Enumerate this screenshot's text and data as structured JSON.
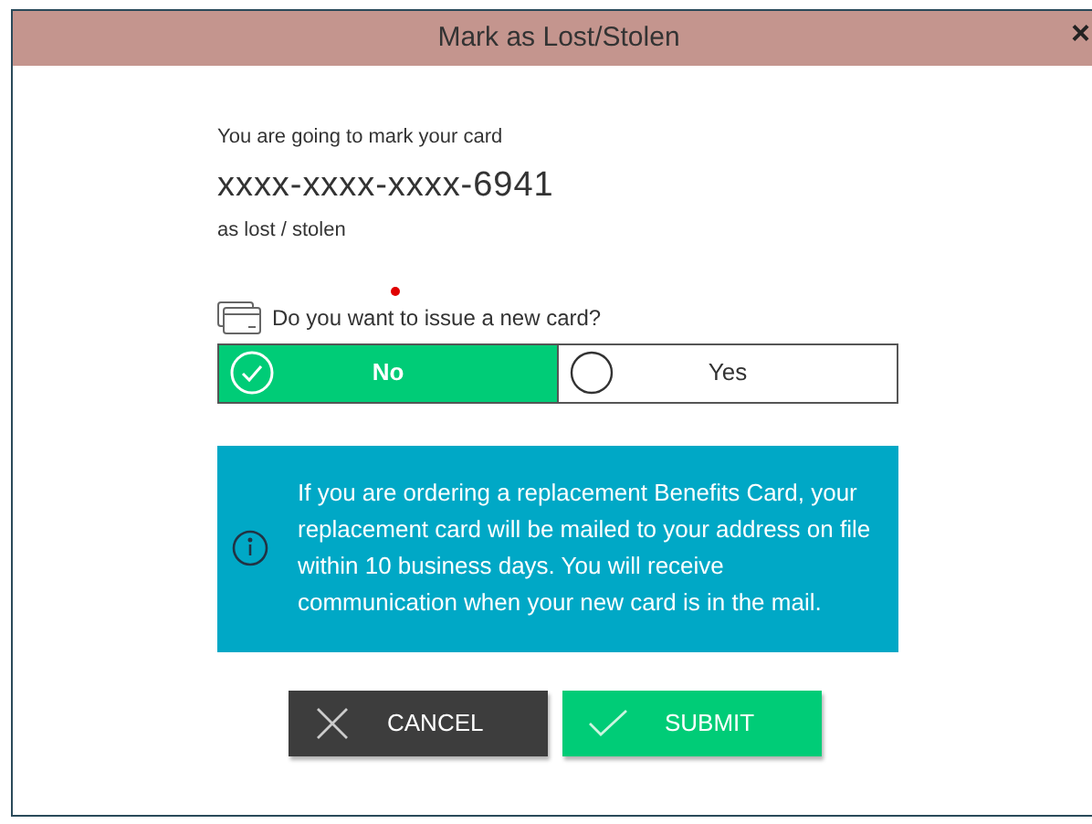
{
  "dialog": {
    "title": "Mark as Lost/Stolen",
    "close": "×"
  },
  "intro": "You are going to mark your card",
  "card_number": "xxxx-xxxx-xxxx-6941",
  "outro": "as lost / stolen",
  "question": "Do you want to issue a new card?",
  "options": [
    {
      "label": "No",
      "selected": true
    },
    {
      "label": "Yes",
      "selected": false
    }
  ],
  "info": "If you are ordering a replacement Benefits Card, your replacement card will be mailed to your address on file within 10 business days. You will receive communication when your new card is in the mail.",
  "buttons": [
    {
      "kind": "cancel",
      "label": "CANCEL"
    },
    {
      "kind": "submit",
      "label": "SUBMIT"
    }
  ]
}
